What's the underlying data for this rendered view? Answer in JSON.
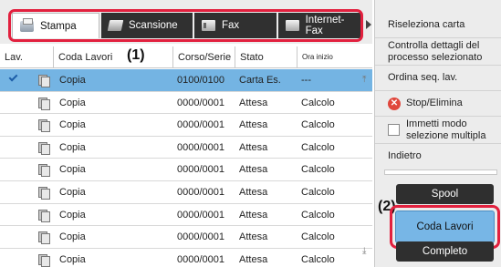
{
  "tabs": [
    {
      "label": "Stampa",
      "icon": "printer-icon",
      "active": true
    },
    {
      "label": "Scansione",
      "icon": "scanner-icon",
      "active": false
    },
    {
      "label": "Fax",
      "icon": "fax-icon",
      "active": false
    },
    {
      "label": "Internet-Fax",
      "icon": "internet-fax-icon",
      "active": false
    }
  ],
  "callouts": {
    "one": "(1)",
    "two": "(2)"
  },
  "table": {
    "columns": [
      "Lav.",
      "Coda Lavori",
      "Corso/Serie",
      "Stato",
      "Ora inizio"
    ],
    "rows": [
      {
        "name": "Copia",
        "progress": "0100/0100",
        "status": "Carta Es.",
        "start": "---",
        "selected": true
      },
      {
        "name": "Copia",
        "progress": "0000/0001",
        "status": "Attesa",
        "start": "Calcolo",
        "selected": false
      },
      {
        "name": "Copia",
        "progress": "0000/0001",
        "status": "Attesa",
        "start": "Calcolo",
        "selected": false
      },
      {
        "name": "Copia",
        "progress": "0000/0001",
        "status": "Attesa",
        "start": "Calcolo",
        "selected": false
      },
      {
        "name": "Copia",
        "progress": "0000/0001",
        "status": "Attesa",
        "start": "Calcolo",
        "selected": false
      },
      {
        "name": "Copia",
        "progress": "0000/0001",
        "status": "Attesa",
        "start": "Calcolo",
        "selected": false
      },
      {
        "name": "Copia",
        "progress": "0000/0001",
        "status": "Attesa",
        "start": "Calcolo",
        "selected": false
      },
      {
        "name": "Copia",
        "progress": "0000/0001",
        "status": "Attesa",
        "start": "Calcolo",
        "selected": false
      },
      {
        "name": "Copia",
        "progress": "0000/0001",
        "status": "Attesa",
        "start": "Calcolo",
        "selected": false
      }
    ]
  },
  "panel": {
    "reselect_paper": "Riseleziona carta",
    "check_details": "Controlla dettagli del processo selezionato",
    "order_seq": "Ordina seq. lav.",
    "stop_delete": "Stop/Elimina",
    "multi_select": "Immetti modo selezione multipla",
    "back": "Indietro",
    "spool": "Spool",
    "job_queue": "Coda Lavori",
    "completed": "Completo"
  },
  "colors": {
    "highlight_red": "#e2203e",
    "selected_row": "#74b4e3",
    "dark_button": "#2f2f2f",
    "active_job_button": "#77b6e6"
  }
}
